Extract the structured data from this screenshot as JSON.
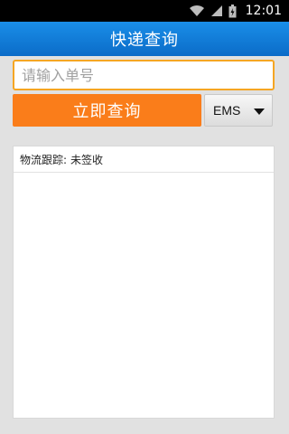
{
  "status_bar": {
    "time": "12:01",
    "icons": [
      "wifi-icon",
      "signal-icon",
      "battery-icon"
    ]
  },
  "header": {
    "title": "快递查询"
  },
  "search": {
    "placeholder": "请输入单号",
    "value": ""
  },
  "actions": {
    "query_label": "立即查询"
  },
  "carrier": {
    "selected": "EMS"
  },
  "result": {
    "status_label": "物流跟踪:",
    "status_value": "未签收"
  },
  "colors": {
    "header": "#0b6cc8",
    "accent": "#fa7d1a",
    "field_border": "#f5a623"
  }
}
